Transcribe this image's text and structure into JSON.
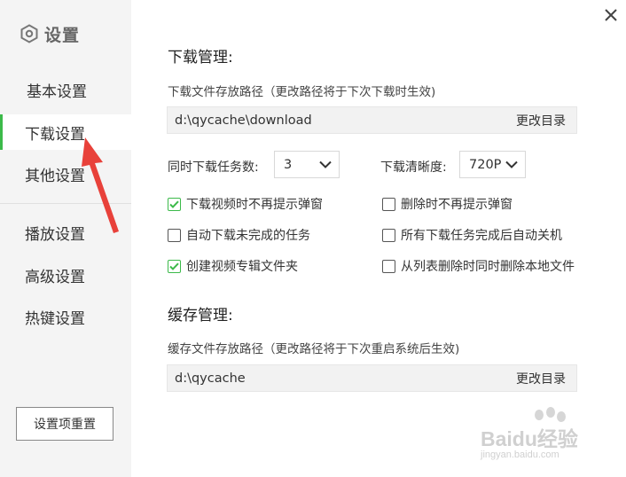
{
  "sidebar": {
    "title": "设置",
    "items": [
      {
        "label": "基本设置",
        "active": false
      },
      {
        "label": "下载设置",
        "active": true
      },
      {
        "label": "其他设置",
        "active": false
      },
      {
        "label": "播放设置",
        "active": false
      },
      {
        "label": "高级设置",
        "active": false
      },
      {
        "label": "热键设置",
        "active": false
      }
    ],
    "reset_label": "设置项重置"
  },
  "download": {
    "section_title": "下载管理:",
    "path_hint": "下载文件存放路径（更改路径将于下次下载时生效)",
    "path_value": "d:\\qycache\\download",
    "change_label": "更改目录",
    "concurrent_label": "同时下载任务数:",
    "concurrent_value": "3",
    "quality_label": "下载清晰度:",
    "quality_value": "720P",
    "options": [
      {
        "label": "下载视频时不再提示弹窗",
        "checked": true
      },
      {
        "label": "删除时不再提示弹窗",
        "checked": false
      },
      {
        "label": "自动下载未完成的任务",
        "checked": false
      },
      {
        "label": "所有下载任务完成后自动关机",
        "checked": false
      },
      {
        "label": "创建视频专辑文件夹",
        "checked": true
      },
      {
        "label": "从列表删除时同时删除本地文件",
        "checked": false
      }
    ]
  },
  "cache": {
    "section_title": "缓存管理:",
    "path_hint": "缓存文件存放路径（更改路径将于下次重启系统后生效)",
    "path_value": "d:\\qycache",
    "change_label": "更改目录"
  },
  "watermark": {
    "text": "Baidu经验",
    "sub": "jingyan.baidu.com"
  },
  "colors": {
    "accent": "#3cba4a",
    "arrow": "#e8413a",
    "sidebar_bg": "#f4f4f4"
  }
}
